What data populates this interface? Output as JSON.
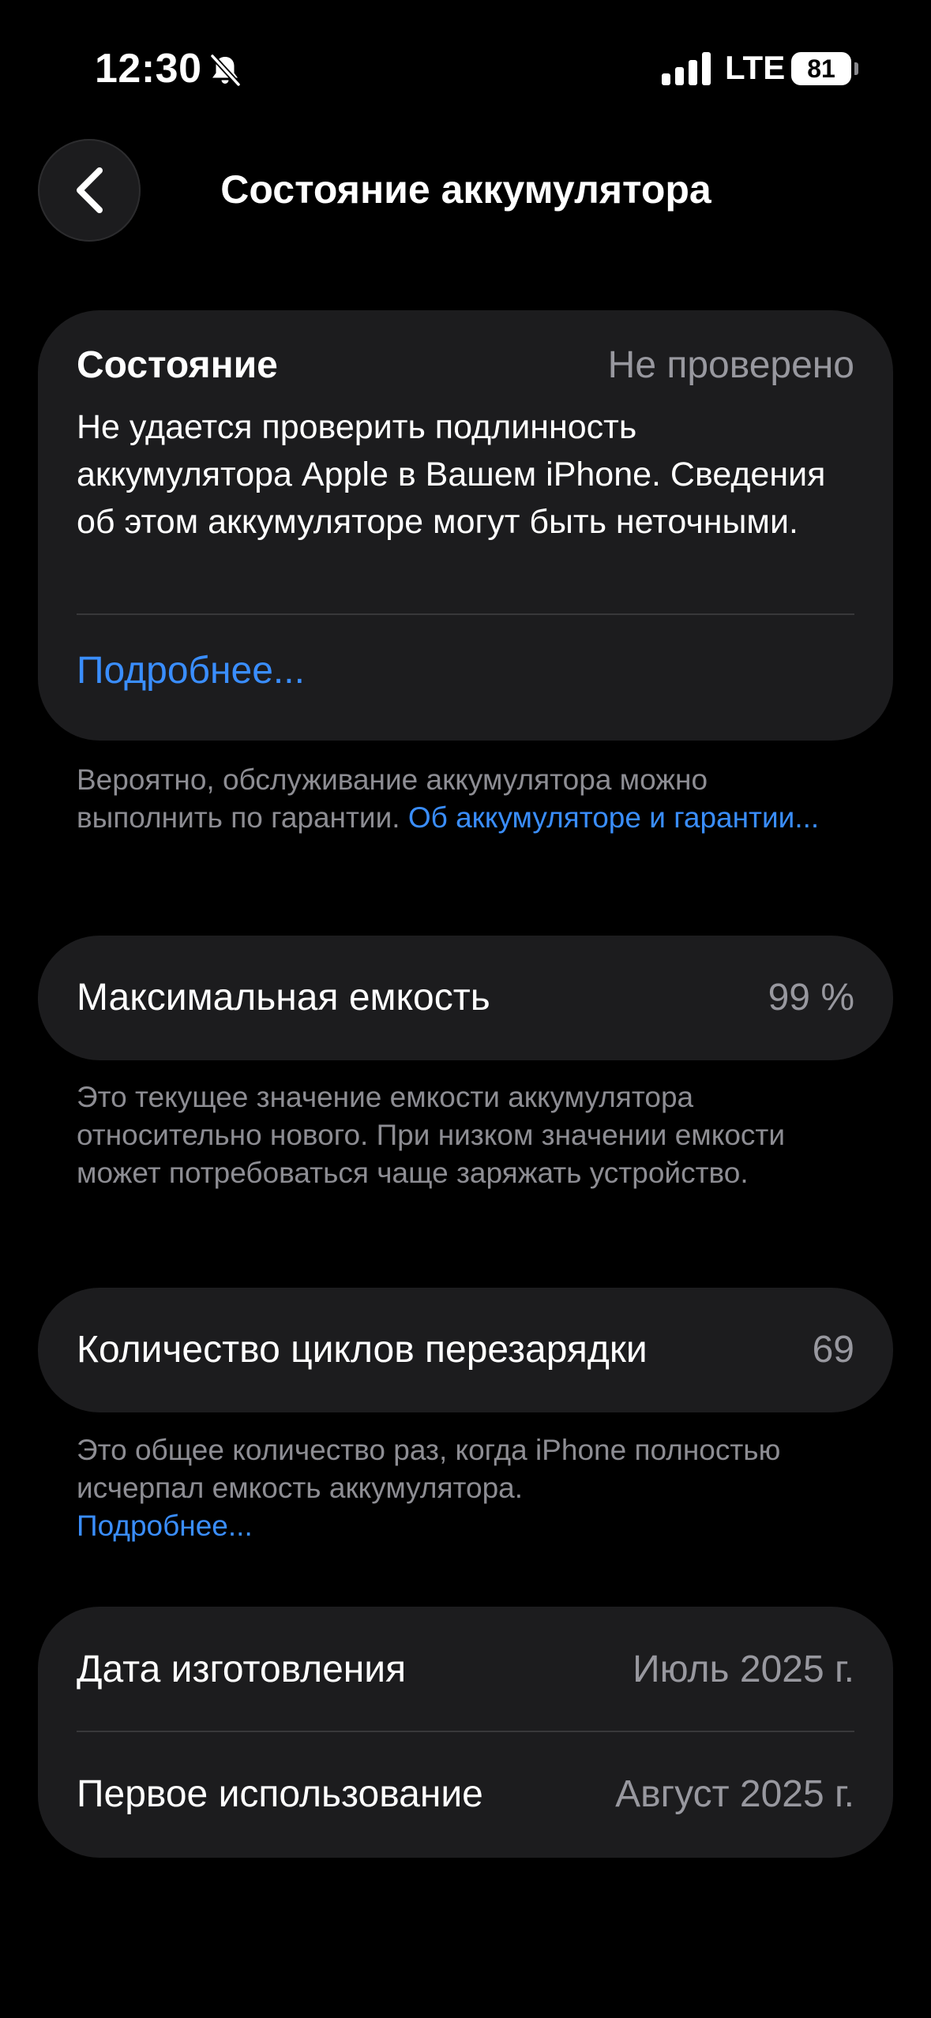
{
  "status_bar": {
    "time": "12:30",
    "network": "LTE",
    "battery_level": "81",
    "icons": [
      "bell-slash-icon",
      "cellular-signal-icon",
      "battery-icon"
    ]
  },
  "nav": {
    "title": "Состояние аккумулятора",
    "back_icon": "chevron-left-icon"
  },
  "condition_card": {
    "title": "Состояние",
    "value": "Не проверено",
    "description": "Не удается проверить подлинность аккумулятора Apple в Вашем iPhone. Сведения об этом аккумуляторе могут быть неточными.",
    "learn_more": "Подробнее..."
  },
  "warranty_note": {
    "text": "Вероятно, обслуживание аккумулятора можно выполнить по гарантии. ",
    "link": "Об аккумуляторе и гарантии..."
  },
  "max_capacity": {
    "title": "Максимальная емкость",
    "value": "99 %",
    "note": "Это текущее значение емкости аккумулятора относительно нового. При низком значении емкости может потребоваться чаще заряжать устройство."
  },
  "cycle_count": {
    "title": "Количество циклов перезарядки",
    "value": "69",
    "note": "Это общее количество раз, когда iPhone полностью исчерпал емкость аккумулятора.",
    "learn_more": "Подробнее..."
  },
  "dates": {
    "manufacture_label": "Дата изготовления",
    "manufacture_value": "Июль 2025 г.",
    "first_use_label": "Первое использование",
    "first_use_value": "Август 2025 г."
  },
  "colors": {
    "background": "#000000",
    "card": "#1c1c1e",
    "secondary_text": "#98989f",
    "link": "#3a8eff",
    "separator": "#38383a"
  }
}
